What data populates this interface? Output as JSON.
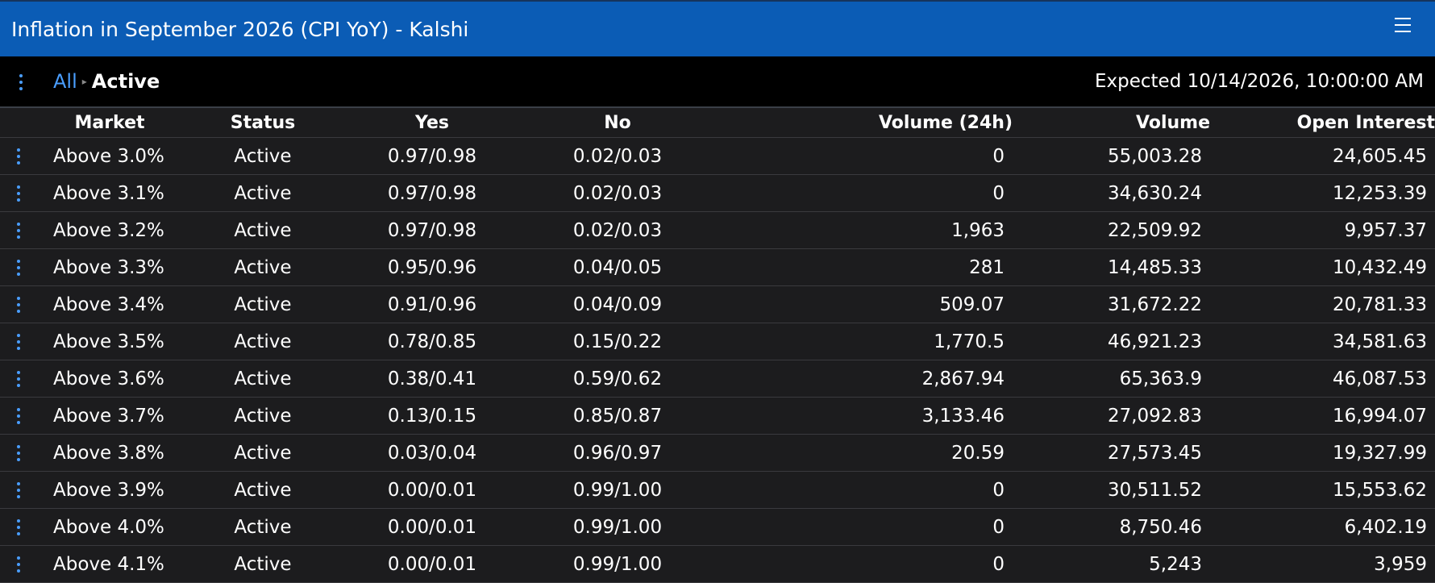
{
  "window": {
    "title": "Inflation in September 2026 (CPI YoY) - Kalshi"
  },
  "breadcrumb": {
    "all_label": "All",
    "separator": "▸",
    "current_label": "Active"
  },
  "expected_text": "Expected 10/14/2026, 10:00:00 AM",
  "icons": {
    "menu": "hamburger-menu-icon",
    "row_menu": "kebab-menu-icon"
  },
  "colors": {
    "titlebar": "#0b5cb5",
    "link": "#4a9eff",
    "background": "#1c1c1e"
  },
  "table": {
    "columns": [
      "Market",
      "Status",
      "Yes",
      "No",
      "Volume (24h)",
      "Volume",
      "Open Interest"
    ],
    "rows": [
      {
        "market": "Above 3.0%",
        "status": "Active",
        "yes": "0.97/0.98",
        "no": "0.02/0.03",
        "volume_24h": "0",
        "volume": "55,003.28",
        "open_interest": "24,605.45"
      },
      {
        "market": "Above 3.1%",
        "status": "Active",
        "yes": "0.97/0.98",
        "no": "0.02/0.03",
        "volume_24h": "0",
        "volume": "34,630.24",
        "open_interest": "12,253.39"
      },
      {
        "market": "Above 3.2%",
        "status": "Active",
        "yes": "0.97/0.98",
        "no": "0.02/0.03",
        "volume_24h": "1,963",
        "volume": "22,509.92",
        "open_interest": "9,957.37"
      },
      {
        "market": "Above 3.3%",
        "status": "Active",
        "yes": "0.95/0.96",
        "no": "0.04/0.05",
        "volume_24h": "281",
        "volume": "14,485.33",
        "open_interest": "10,432.49"
      },
      {
        "market": "Above 3.4%",
        "status": "Active",
        "yes": "0.91/0.96",
        "no": "0.04/0.09",
        "volume_24h": "509.07",
        "volume": "31,672.22",
        "open_interest": "20,781.33"
      },
      {
        "market": "Above 3.5%",
        "status": "Active",
        "yes": "0.78/0.85",
        "no": "0.15/0.22",
        "volume_24h": "1,770.5",
        "volume": "46,921.23",
        "open_interest": "34,581.63"
      },
      {
        "market": "Above 3.6%",
        "status": "Active",
        "yes": "0.38/0.41",
        "no": "0.59/0.62",
        "volume_24h": "2,867.94",
        "volume": "65,363.9",
        "open_interest": "46,087.53"
      },
      {
        "market": "Above 3.7%",
        "status": "Active",
        "yes": "0.13/0.15",
        "no": "0.85/0.87",
        "volume_24h": "3,133.46",
        "volume": "27,092.83",
        "open_interest": "16,994.07"
      },
      {
        "market": "Above 3.8%",
        "status": "Active",
        "yes": "0.03/0.04",
        "no": "0.96/0.97",
        "volume_24h": "20.59",
        "volume": "27,573.45",
        "open_interest": "19,327.99"
      },
      {
        "market": "Above 3.9%",
        "status": "Active",
        "yes": "0.00/0.01",
        "no": "0.99/1.00",
        "volume_24h": "0",
        "volume": "30,511.52",
        "open_interest": "15,553.62"
      },
      {
        "market": "Above 4.0%",
        "status": "Active",
        "yes": "0.00/0.01",
        "no": "0.99/1.00",
        "volume_24h": "0",
        "volume": "8,750.46",
        "open_interest": "6,402.19"
      },
      {
        "market": "Above 4.1%",
        "status": "Active",
        "yes": "0.00/0.01",
        "no": "0.99/1.00",
        "volume_24h": "0",
        "volume": "5,243",
        "open_interest": "3,959"
      }
    ]
  }
}
